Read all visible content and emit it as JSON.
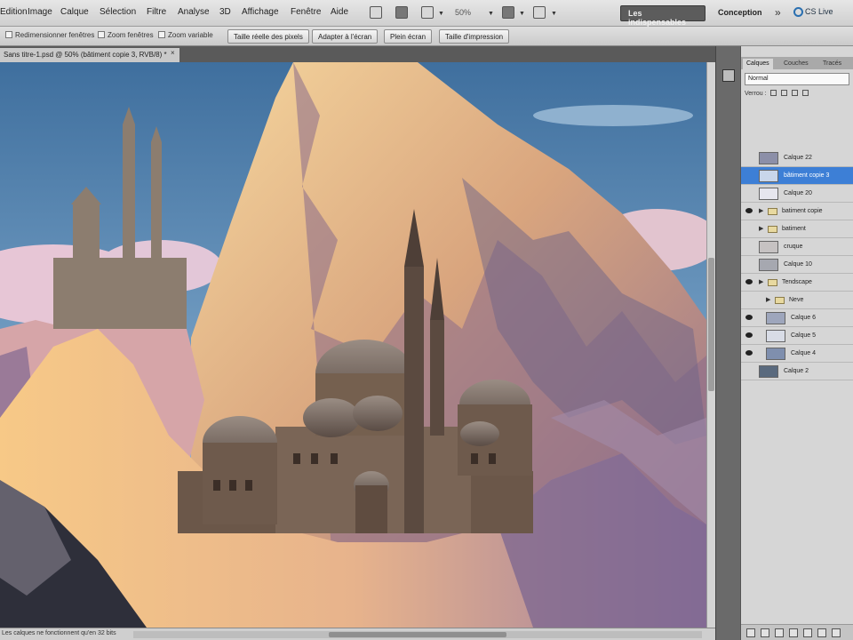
{
  "menu": {
    "items": [
      "Edition",
      "Image",
      "Calque",
      "Sélection",
      "Filtre",
      "Analyse",
      "3D",
      "Affichage",
      "Fenêtre",
      "Aide"
    ]
  },
  "toolbar": {
    "zoom_value": "50%",
    "workspace_active": "Les indispensables",
    "workspace_design": "Conception",
    "more_label": "»",
    "cslive_label": "CS Live"
  },
  "options_bar": {
    "checks": [
      "Redimensionner fenêtres",
      "Zoom fenêtres",
      "Zoom variable"
    ],
    "buttons": [
      "Taille réelle des pixels",
      "Adapter à l'écran",
      "Plein écran",
      "Taille d'impression"
    ]
  },
  "document": {
    "tab_title": "Sans titre-1.psd @ 50% (bâtiment copie 3, RVB/8) *",
    "close_label": "×",
    "status": "Les calques ne fonctionnent qu'en 32 bits"
  },
  "layers_panel": {
    "tabs": [
      "Calques",
      "Couches",
      "Tracés"
    ],
    "blend_mode": "Normal",
    "lock_label": "Verrou :",
    "layers": [
      {
        "name": "Calque 22",
        "selected": false,
        "visible": false,
        "group": false,
        "indent": 0,
        "thumb": "#8c8fa8"
      },
      {
        "name": "bâtiment copie 3",
        "selected": true,
        "visible": false,
        "group": false,
        "indent": 0,
        "thumb": "#c9d6ea"
      },
      {
        "name": "Calque 20",
        "selected": false,
        "visible": false,
        "group": false,
        "indent": 0,
        "thumb": "#e6e6ee"
      },
      {
        "name": "batiment copie",
        "selected": false,
        "visible": true,
        "group": true,
        "indent": 0,
        "thumb": ""
      },
      {
        "name": "batiment",
        "selected": false,
        "visible": false,
        "group": true,
        "indent": 0,
        "thumb": ""
      },
      {
        "name": "cruque",
        "selected": false,
        "visible": false,
        "group": false,
        "indent": 0,
        "thumb": "#c6c2c2"
      },
      {
        "name": "Calque 10",
        "selected": false,
        "visible": false,
        "group": false,
        "indent": 0,
        "thumb": "#a6a8b0"
      },
      {
        "name": "Tendscape",
        "selected": false,
        "visible": true,
        "group": true,
        "indent": 0,
        "thumb": ""
      },
      {
        "name": "Neve",
        "selected": false,
        "visible": false,
        "group": true,
        "indent": 1,
        "thumb": ""
      },
      {
        "name": "Calque 6",
        "selected": false,
        "visible": true,
        "group": false,
        "indent": 1,
        "thumb": "#9ea6bc"
      },
      {
        "name": "Calque 5",
        "selected": false,
        "visible": true,
        "group": false,
        "indent": 1,
        "thumb": "#d8dce6"
      },
      {
        "name": "Calque 4",
        "selected": false,
        "visible": true,
        "group": false,
        "indent": 1,
        "thumb": "#7f8fae"
      },
      {
        "name": "Calque 2",
        "selected": false,
        "visible": false,
        "group": false,
        "indent": 0,
        "thumb": "#5a6a7e"
      }
    ]
  },
  "colors": {
    "selection": "#3d7fd6",
    "sky": "#5a84b0",
    "mountain_light": "#f2c98a",
    "mountain_shadow": "#8a6c8a"
  }
}
